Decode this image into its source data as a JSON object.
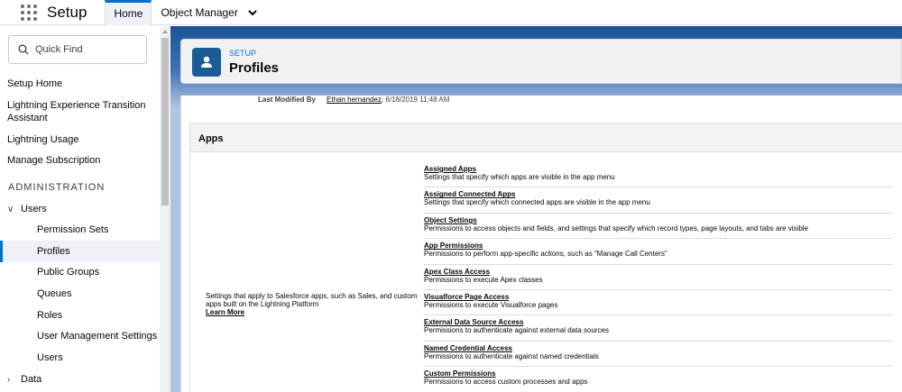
{
  "topbar": {
    "app_name": "Setup",
    "tabs": [
      {
        "label": "Home"
      },
      {
        "label": "Object Manager"
      }
    ]
  },
  "sidebar": {
    "search_placeholder": "Quick Find",
    "items": [
      {
        "label": "Setup Home"
      },
      {
        "label": "Lightning Experience Transition Assistant"
      },
      {
        "label": "Lightning Usage"
      },
      {
        "label": "Manage Subscription"
      }
    ],
    "section": "ADMINISTRATION",
    "users_group": "Users",
    "users_children": [
      "Permission Sets",
      "Profiles",
      "Public Groups",
      "Queues",
      "Roles",
      "User Management Settings",
      "Users"
    ],
    "data_group": "Data",
    "active": "Profiles"
  },
  "header": {
    "breadcrumb": "SETUP",
    "title": "Profiles"
  },
  "last_modified": {
    "label": "Last Modified By",
    "user": "Ethan hernandez",
    "date": ", 6/18/2019 11:48 AM"
  },
  "apps": {
    "heading": "Apps",
    "description": "Settings that apply to Salesforce apps, such as Sales, and custom apps built on the Lightning Platform",
    "learn_more": "Learn More",
    "permissions": [
      {
        "title": "Assigned Apps",
        "desc": "Settings that specify which apps are visible in the app menu"
      },
      {
        "title": "Assigned Connected Apps",
        "desc": "Settings that specify which connected apps are visible in the app menu"
      },
      {
        "title": "Object Settings",
        "desc": "Permissions to access objects and fields, and settings that specify which record types, page layouts, and tabs are visible"
      },
      {
        "title": "App Permissions",
        "desc": "Permissions to perform app-specific actions, such as \"Manage Call Centers\""
      },
      {
        "title": "Apex Class Access",
        "desc": "Permissions to execute Apex classes"
      },
      {
        "title": "Visualforce Page Access",
        "desc": "Permissions to execute Visualforce pages"
      },
      {
        "title": "External Data Source Access",
        "desc": "Permissions to authenticate against external data sources"
      },
      {
        "title": "Named Credential Access",
        "desc": "Permissions to authenticate against named credentials"
      },
      {
        "title": "Custom Permissions",
        "desc": "Permissions to access custom processes and apps"
      }
    ]
  },
  "colors": {
    "accent": "#0070d2",
    "header_band": "#1b5297",
    "profile_icon": "#1b5c96"
  },
  "icons": [
    "app-launcher-icon",
    "chevron-down-icon",
    "search-icon",
    "user-profile-icon",
    "chevron-right-icon"
  ]
}
